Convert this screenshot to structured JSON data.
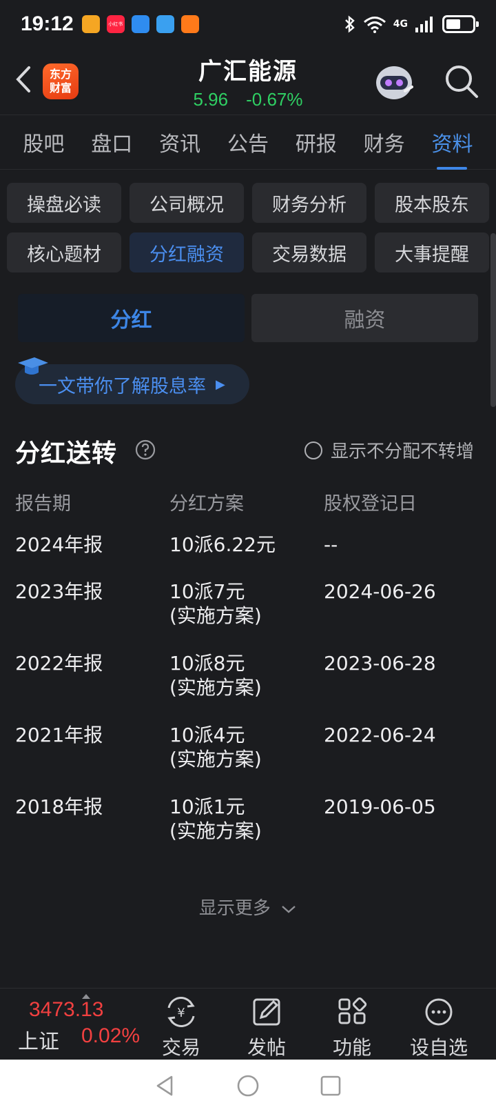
{
  "status_bar": {
    "time": "19:12",
    "app_icons": [
      {
        "name": "app-icon-yellow",
        "color": "#f5a623",
        "label": ""
      },
      {
        "name": "app-icon-xiaohongshu",
        "color": "#ff2442",
        "label": "小红书"
      },
      {
        "name": "app-icon-weather",
        "color": "#2f8cf0",
        "label": ""
      },
      {
        "name": "app-icon-browser",
        "color": "#3aa0f0",
        "label": ""
      },
      {
        "name": "app-icon-orange",
        "color": "#ff7a1a",
        "label": ""
      }
    ],
    "network": "4G",
    "battery_level": 0.55
  },
  "header": {
    "logo_line1": "东方",
    "logo_line2": "财富",
    "stock_name": "广汇能源",
    "price": "5.96",
    "change": "-0.67%",
    "quote_color": "#2fcf63"
  },
  "main_tabs": [
    {
      "label": "股吧",
      "active": false
    },
    {
      "label": "盘口",
      "active": false
    },
    {
      "label": "资讯",
      "active": false
    },
    {
      "label": "公告",
      "active": false
    },
    {
      "label": "研报",
      "active": false
    },
    {
      "label": "财务",
      "active": false
    },
    {
      "label": "资料",
      "active": true
    }
  ],
  "sub_tabs": [
    {
      "label": "操盘必读",
      "active": false
    },
    {
      "label": "公司概况",
      "active": false
    },
    {
      "label": "财务分析",
      "active": false
    },
    {
      "label": "股本股东",
      "active": false
    },
    {
      "label": "核心题材",
      "active": false
    },
    {
      "label": "分红融资",
      "active": true
    },
    {
      "label": "交易数据",
      "active": false
    },
    {
      "label": "大事提醒",
      "active": false
    }
  ],
  "segment": {
    "dividend": "分红",
    "financing": "融资",
    "active": "dividend"
  },
  "promo": {
    "text": "一文带你了解股息率"
  },
  "section": {
    "title": "分红送转",
    "option_label": "显示不分配不转增",
    "option_checked": false
  },
  "table": {
    "headers": [
      "报告期",
      "分红方案",
      "股权登记日"
    ],
    "rows": [
      [
        "2024年报",
        "10派6.22元",
        "--"
      ],
      [
        "2023年报",
        "10派7元\n(实施方案)",
        "2024-06-26"
      ],
      [
        "2022年报",
        "10派8元\n(实施方案)",
        "2023-06-28"
      ],
      [
        "2021年报",
        "10派4元\n(实施方案)",
        "2022-06-24"
      ],
      [
        "2018年报",
        "10派1元\n(实施方案)",
        "2019-06-05"
      ]
    ]
  },
  "show_more": "显示更多",
  "bottom_bar": {
    "index_value": "3473.13",
    "index_name": "上证",
    "index_change": "0.02%",
    "index_color": "#f24040",
    "tools": [
      {
        "label": "交易",
        "icon": "yuan-exchange-icon"
      },
      {
        "label": "发帖",
        "icon": "edit-post-icon"
      },
      {
        "label": "功能",
        "icon": "grid-apps-icon"
      },
      {
        "label": "设自选",
        "icon": "more-circle-icon"
      }
    ]
  },
  "colors": {
    "accent": "#3e87e8",
    "background": "#1b1c1f",
    "card": "#2a2b2f"
  }
}
